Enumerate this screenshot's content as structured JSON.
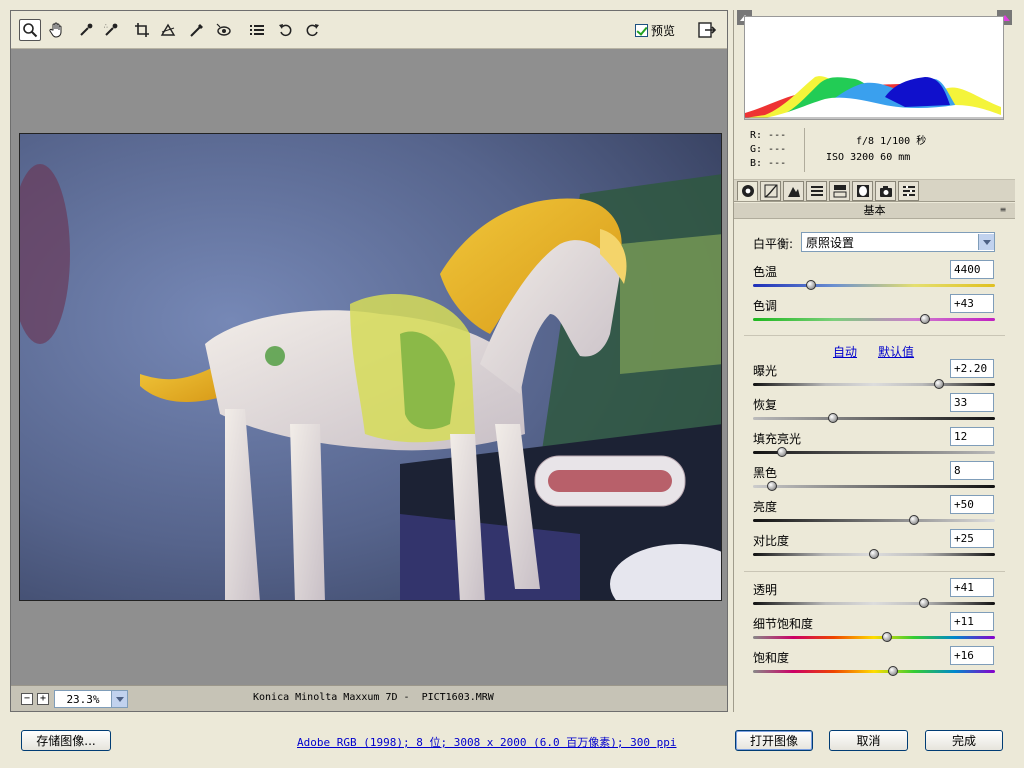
{
  "toolbar": {
    "tools": [
      {
        "icon": "zoom-tool-icon",
        "active": true
      },
      {
        "icon": "hand-tool-icon"
      },
      {
        "icon": "white-balance-tool-icon"
      },
      {
        "icon": "color-sampler-tool-icon"
      },
      {
        "icon": "crop-tool-icon"
      },
      {
        "icon": "straighten-tool-icon"
      },
      {
        "icon": "retouch-tool-icon"
      },
      {
        "icon": "red-eye-tool-icon"
      },
      {
        "icon": "preferences-icon"
      },
      {
        "icon": "rotate-left-icon"
      },
      {
        "icon": "rotate-right-icon"
      }
    ],
    "preview_label": "预览",
    "preview_checked": true
  },
  "statusbar": {
    "zoom_out": "−",
    "zoom_in": "+",
    "zoom_value": "23.3%",
    "camera_file": "Konica Minolta Maxxum 7D -  PICT1603.MRW"
  },
  "readout": {
    "r": "R:  ---",
    "g": "G:  ---",
    "b": "B:  ---",
    "exposure": "f/8  1/100 秒",
    "iso_focal": "ISO 3200  60 mm"
  },
  "panel": {
    "section_title": "基本",
    "white_balance_label": "白平衡:",
    "white_balance_value": "原照设置",
    "auto_label": "自动",
    "default_label": "默认值",
    "sliders": {
      "temperature": {
        "label": "色温",
        "value": "4400",
        "fraction": 0.24
      },
      "tint": {
        "label": "色调",
        "value": "+43",
        "fraction": 0.71
      },
      "exposure": {
        "label": "曝光",
        "value": "+2.20",
        "fraction": 0.77
      },
      "recovery": {
        "label": "恢复",
        "value": "33",
        "fraction": 0.33
      },
      "fill_light": {
        "label": "填充亮光",
        "value": "12",
        "fraction": 0.12
      },
      "blacks": {
        "label": "黑色",
        "value": "8",
        "fraction": 0.08
      },
      "brightness": {
        "label": "亮度",
        "value": "+50",
        "fraction": 0.665
      },
      "contrast": {
        "label": "对比度",
        "value": "+25",
        "fraction": 0.5
      },
      "clarity": {
        "label": "透明",
        "value": "+41",
        "fraction": 0.705
      },
      "vibrance": {
        "label": "细节饱和度",
        "value": "+11",
        "fraction": 0.555
      },
      "saturation": {
        "label": "饱和度",
        "value": "+16",
        "fraction": 0.58
      }
    }
  },
  "footer": {
    "save_label": "存储图像...",
    "workflow": "Adobe RGB (1998); 8 位; 3008 x 2000 (6.0 百万像素); 300 ppi",
    "open_label": "打开图像",
    "cancel_label": "取消",
    "done_label": "完成"
  }
}
